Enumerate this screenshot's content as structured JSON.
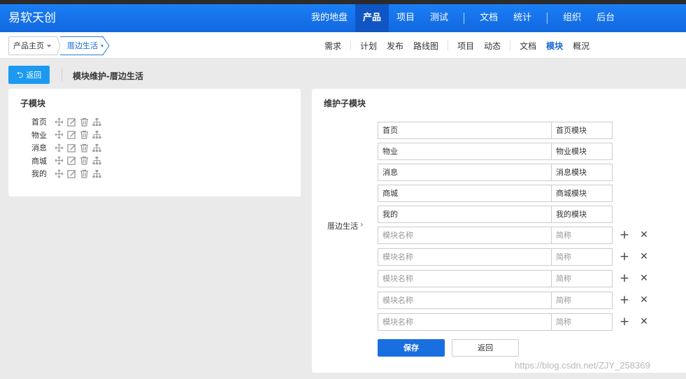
{
  "app": {
    "brand": "易软天创"
  },
  "topnav": {
    "items": [
      {
        "label": "我的地盘",
        "active": false
      },
      {
        "label": "产品",
        "active": true
      },
      {
        "label": "项目",
        "active": false
      },
      {
        "label": "测试",
        "active": false
      },
      {
        "label": "文档",
        "active": false
      },
      {
        "label": "统计",
        "active": false
      },
      {
        "label": "组织",
        "active": false
      },
      {
        "label": "后台",
        "active": false
      }
    ]
  },
  "breadcrumb": {
    "home": "产品主页",
    "current": "厝边生活"
  },
  "subnav": {
    "items": [
      {
        "label": "需求"
      },
      {
        "label": "计划"
      },
      {
        "label": "发布"
      },
      {
        "label": "路线图"
      },
      {
        "label": "项目"
      },
      {
        "label": "动态"
      },
      {
        "label": "文档"
      },
      {
        "label": "模块",
        "active": true
      },
      {
        "label": "概況"
      }
    ]
  },
  "toolbar": {
    "back_label": "返回",
    "back_icon": "undo-icon",
    "page_title": "模块维护-厝边生活"
  },
  "left_panel": {
    "title": "子模块",
    "modules": [
      {
        "name": "首页"
      },
      {
        "name": "物业"
      },
      {
        "name": "消息"
      },
      {
        "name": "商城"
      },
      {
        "name": "我的"
      }
    ],
    "row_icons": [
      "move-icon",
      "edit-icon",
      "delete-icon",
      "structure-icon"
    ]
  },
  "right_panel": {
    "title": "维护子模块",
    "parent_label": "厝边生活",
    "existing": [
      {
        "name": "首页",
        "short": "首页模块"
      },
      {
        "name": "物业",
        "short": "物业模块"
      },
      {
        "name": "消息",
        "short": "消息模块"
      },
      {
        "name": "商城",
        "short": "商城模块"
      },
      {
        "name": "我的",
        "short": "我的模块"
      }
    ],
    "new_rows": [
      {
        "name_placeholder": "模块名称",
        "short_placeholder": "简称"
      },
      {
        "name_placeholder": "模块名称",
        "short_placeholder": "简称"
      },
      {
        "name_placeholder": "模块名称",
        "short_placeholder": "简称"
      },
      {
        "name_placeholder": "模块名称",
        "short_placeholder": "简称"
      },
      {
        "name_placeholder": "模块名称",
        "short_placeholder": "简称"
      }
    ],
    "add_symbol": "+",
    "remove_symbol": "✕",
    "save_label": "保存",
    "cancel_label": "返回"
  },
  "watermark": "https://blog.csdn.net/ZJY_258369",
  "colors": {
    "nav_bg": "#1a7ef5",
    "nav_active": "#0f56c4",
    "primary": "#1a6fe0",
    "back_button": "#1b9af0",
    "link": "#1768d8",
    "page_bg": "#eaeaea"
  }
}
